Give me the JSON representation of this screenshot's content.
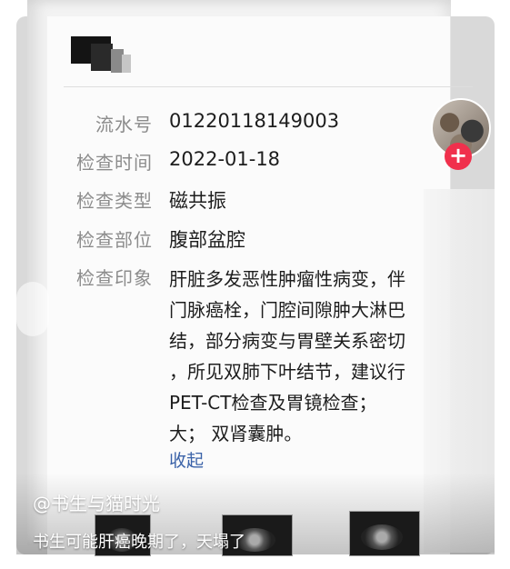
{
  "report": {
    "fields": [
      {
        "label": "流水号",
        "value": "01220118149003"
      },
      {
        "label": "检查时间",
        "value": "2022-01-18"
      },
      {
        "label": "检查类型",
        "value": "磁共振"
      },
      {
        "label": "检查部位",
        "value": "腹部盆腔"
      }
    ],
    "impression_label": "检查印象",
    "impression_lines": [
      "肝脏多发恶性肿瘤性病变，伴",
      "门脉癌栓，门腔间隙肿大淋巴",
      "结，部分病变与胃壁关系密切",
      "，所见双肺下叶结节，建议行",
      "PET-CT检查及胃镜检查；",
      "大；  双肾囊肿。"
    ],
    "collapse_link": "收起"
  },
  "overlay": {
    "username": "@书生与猫时光",
    "caption": "书生可能肝癌晚期了，天塌了",
    "follow_symbol": "+"
  }
}
